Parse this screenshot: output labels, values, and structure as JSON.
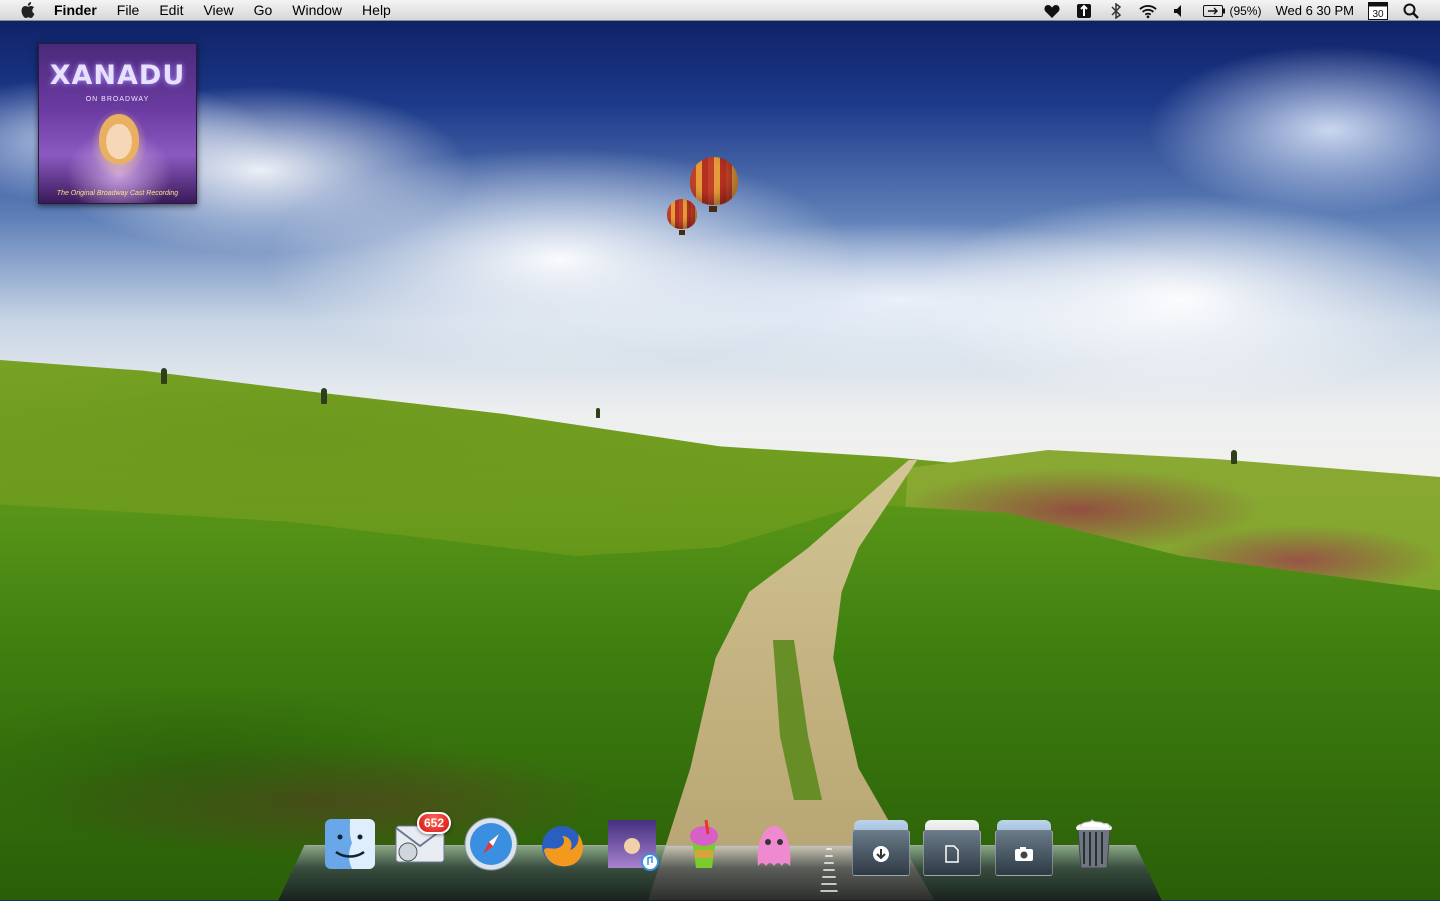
{
  "menubar": {
    "app_name": "Finder",
    "menus": [
      "File",
      "Edit",
      "View",
      "Go",
      "Window",
      "Help"
    ],
    "battery_percent": "(95%)",
    "clock": "Wed 6 30 PM",
    "calendar_day": "30"
  },
  "desktop": {
    "album_widget": {
      "title": "XANADU",
      "subtitle": "ON BROADWAY",
      "footer": "The Original Broadway Cast Recording"
    }
  },
  "dock": {
    "mail_badge": "652",
    "items": [
      "finder-icon",
      "mail-icon",
      "safari-icon",
      "firefox-icon",
      "itunes-icon",
      "slurpee-icon",
      "pink-monster-icon",
      "downloads-stack-icon",
      "documents-stack-icon",
      "pictures-stack-icon",
      "trash-icon"
    ]
  }
}
